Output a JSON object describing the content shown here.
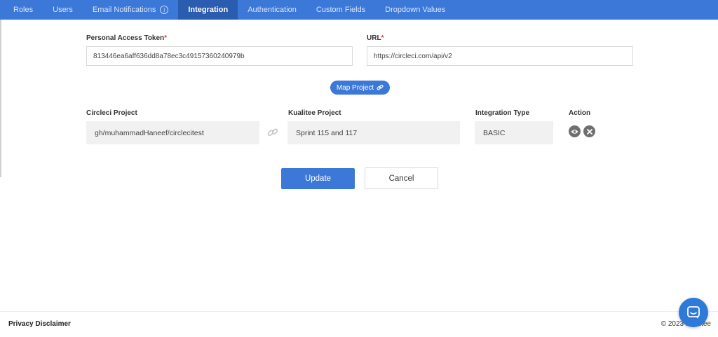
{
  "tabs": [
    {
      "label": "Roles"
    },
    {
      "label": "Users"
    },
    {
      "label": "Email Notifications"
    },
    {
      "label": "Integration"
    },
    {
      "label": "Authentication"
    },
    {
      "label": "Custom Fields"
    },
    {
      "label": "Dropdown Values"
    }
  ],
  "active_tab": "Integration",
  "form": {
    "token_label": "Personal Access Token",
    "token_value": "813446ea6aff636dd8a78ec3c49157360240979b",
    "url_label": "URL",
    "url_value": "https://circleci.com/api/v2",
    "required_mark": "*"
  },
  "map_project_label": "Map Project",
  "mapping": {
    "headers": {
      "circleci": "Circleci Project",
      "kualitee": "Kualitee Project",
      "type": "Integration Type",
      "action": "Action"
    },
    "row": {
      "circleci": "gh/muhammadHaneef/circlecitest",
      "kualitee": "Sprint 115 and 117",
      "type": "BASIC"
    }
  },
  "buttons": {
    "update": "Update",
    "cancel": "Cancel"
  },
  "footer": {
    "left": "Privacy Disclaimer",
    "right": "© 2023 Kualitee"
  },
  "colors": {
    "primary": "#3b78d8",
    "active_tab": "#2a5cb0",
    "required": "#e23b3b"
  },
  "icons": [
    "info-icon",
    "link-icon",
    "eye-icon",
    "close-icon",
    "chat-icon"
  ]
}
